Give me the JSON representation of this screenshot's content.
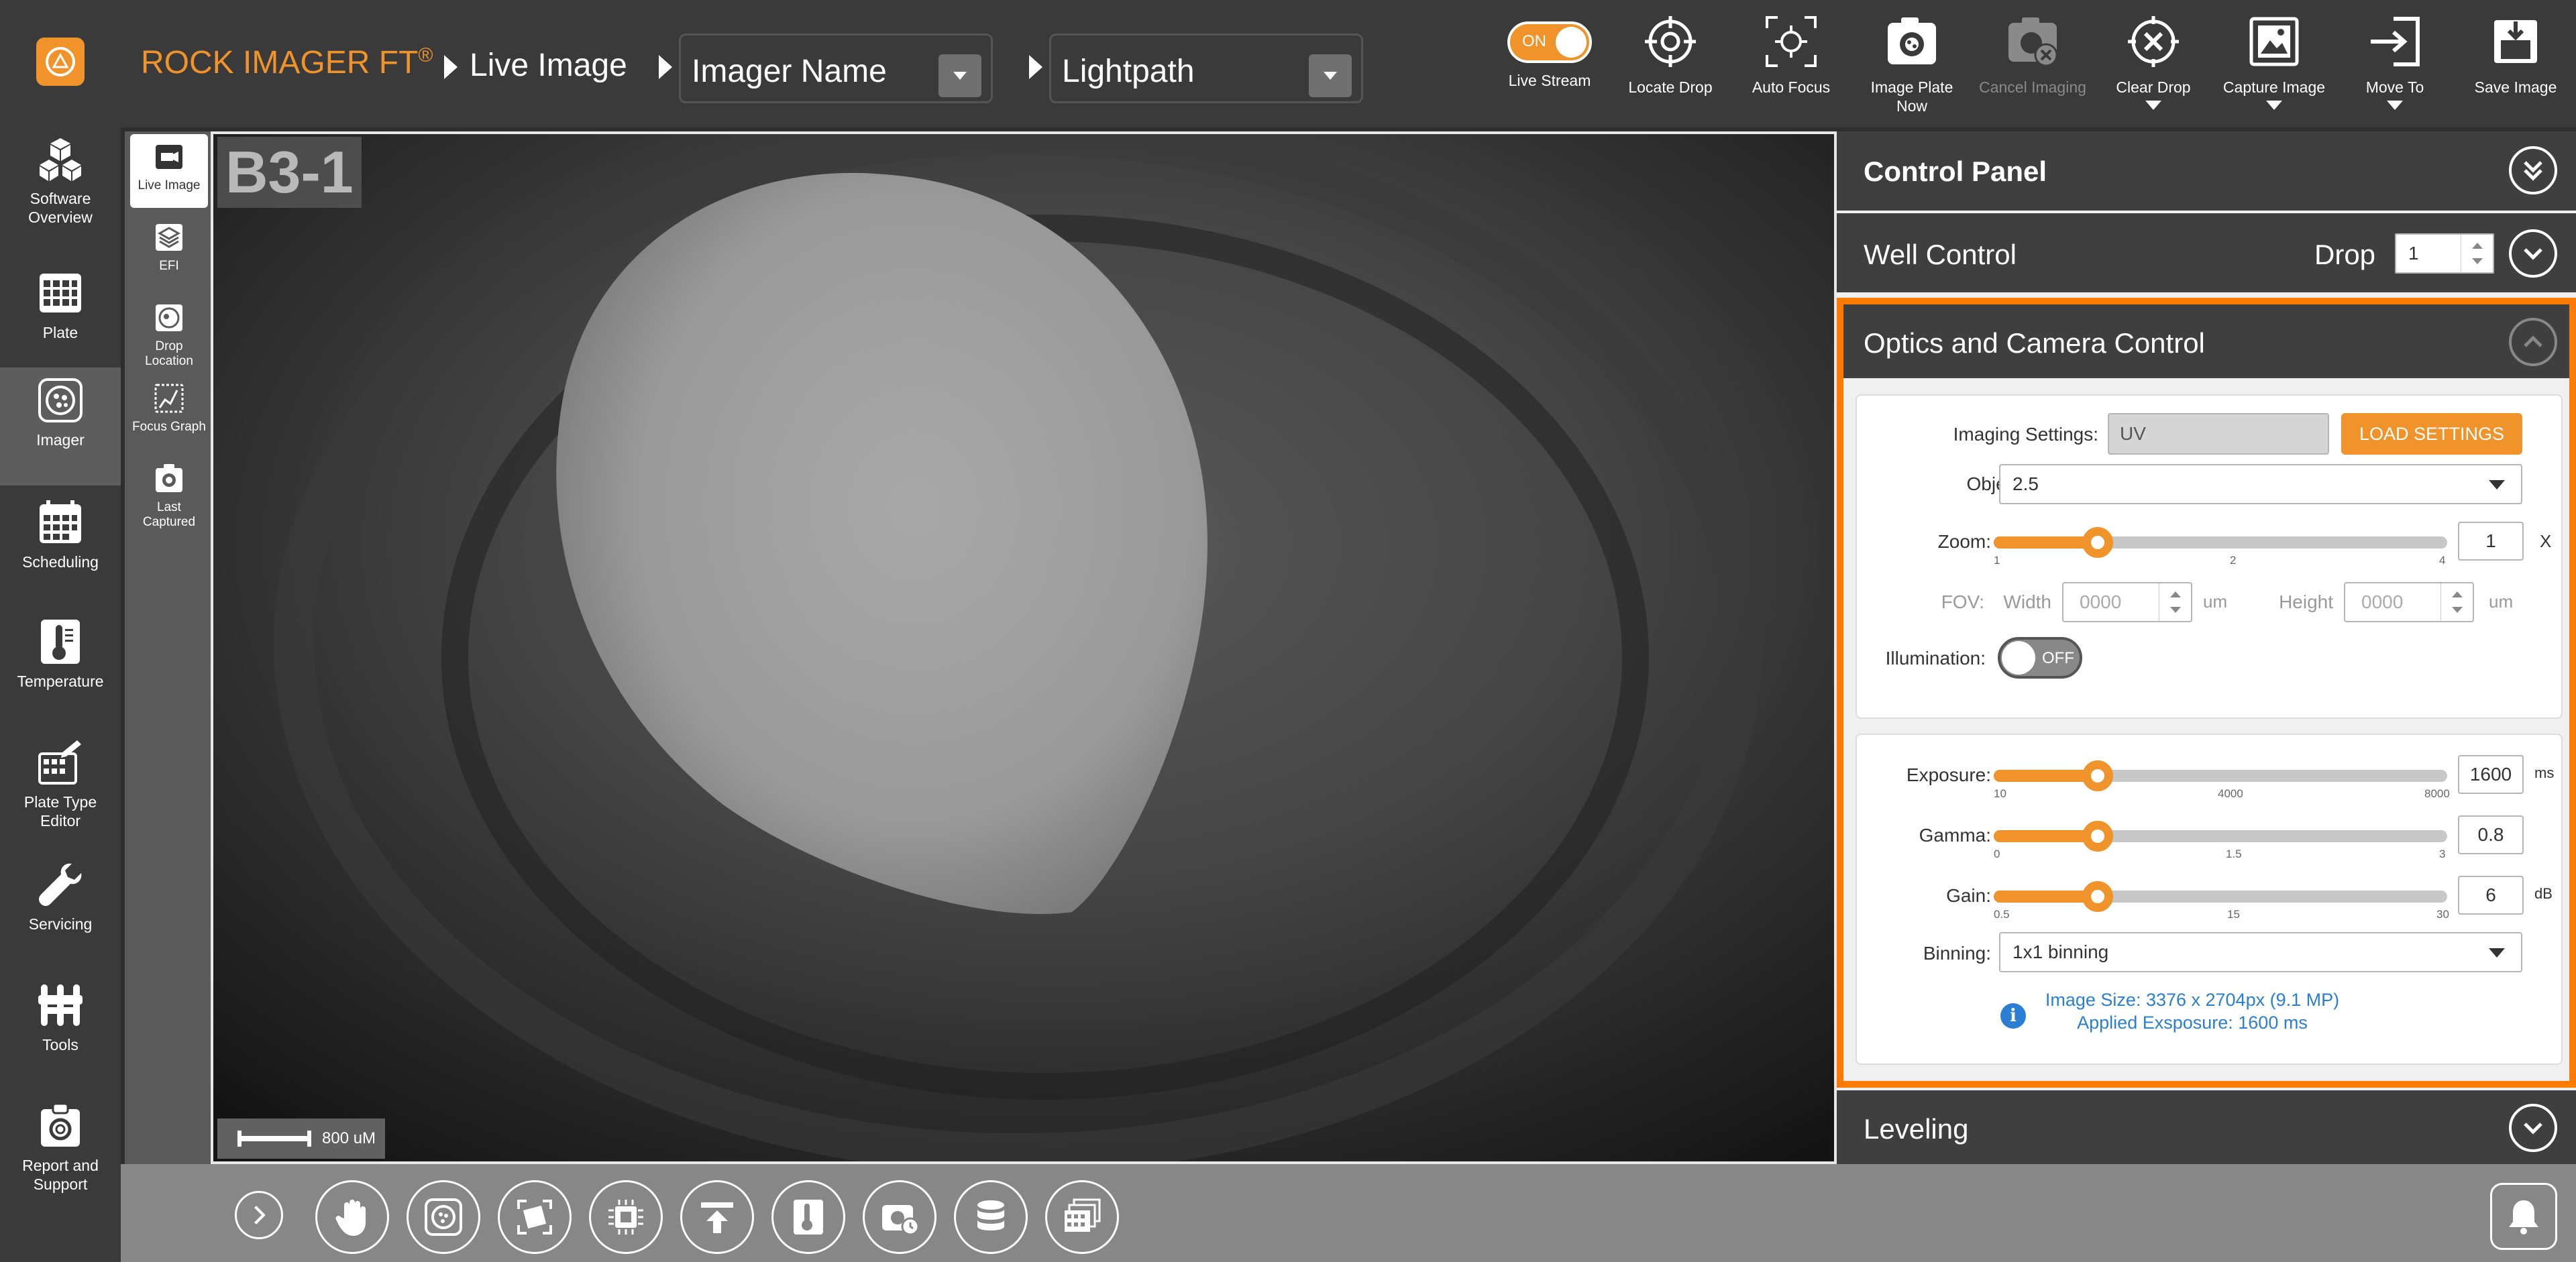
{
  "app": {
    "title": "ROCK IMAGER FT",
    "reg_mark": "®"
  },
  "breadcrumb": {
    "page": "Live Image",
    "imager_name": "Imager Name",
    "lightpath": "Lightpath"
  },
  "left_nav": [
    {
      "label": "Software Overview",
      "icon": "cubes-icon"
    },
    {
      "label": "Plate",
      "icon": "grid-icon"
    },
    {
      "label": "Imager",
      "icon": "microscope-plate-icon",
      "active": true
    },
    {
      "label": "Scheduling",
      "icon": "calendar-icon"
    },
    {
      "label": "Temperature",
      "icon": "thermometer-icon"
    },
    {
      "label": "Plate Type Editor",
      "icon": "plate-edit-icon"
    },
    {
      "label": "Servicing",
      "icon": "wrench-icon"
    },
    {
      "label": "Tools",
      "icon": "tools-icon"
    },
    {
      "label": "Report and Support",
      "icon": "support-icon"
    }
  ],
  "toolbar": {
    "live_stream": {
      "label": "Live Stream",
      "toggle": "ON"
    },
    "buttons": [
      {
        "label": "Locate Drop",
        "icon": "crosshair-icon"
      },
      {
        "label": "Auto Focus",
        "icon": "autofocus-icon"
      },
      {
        "label": "Image Plate Now",
        "icon": "camera-plate-icon"
      },
      {
        "label": "Cancel Imaging",
        "icon": "cancel-camera-icon",
        "disabled": true
      },
      {
        "label": "Clear Drop",
        "icon": "clear-drop-icon",
        "caret": true
      },
      {
        "label": "Capture Image",
        "icon": "capture-image-icon",
        "caret": true
      },
      {
        "label": "Move To",
        "icon": "move-to-icon",
        "caret": true
      },
      {
        "label": "Save Image",
        "icon": "save-image-icon"
      }
    ]
  },
  "sub_nav": [
    {
      "label": "Live Image",
      "active": true
    },
    {
      "label": "EFI"
    },
    {
      "label": "Drop Location"
    },
    {
      "label": "Focus Graph"
    },
    {
      "label": "Last Captured"
    }
  ],
  "viewer": {
    "well": "B3-1",
    "scale": "800 uM"
  },
  "panel": {
    "control_panel": "Control Panel",
    "well_control": {
      "title": "Well Control",
      "drop_label": "Drop",
      "drop_value": "1"
    },
    "optics": {
      "title": "Optics and Camera Control",
      "imaging_settings_label": "Imaging Settings:",
      "imaging_settings_value": "UV",
      "load_button": "LOAD SETTINGS",
      "objective_label": "Objective:",
      "objective_value": "2.5",
      "zoom": {
        "label": "Zoom:",
        "value": "1",
        "unit": "X",
        "ticks": [
          "1",
          "2",
          "4"
        ],
        "level": 0.23
      },
      "fov": {
        "label": "FOV:",
        "width_label": "Width",
        "width_value": "0000",
        "height_label": "Height",
        "height_value": "0000",
        "unit": "um"
      },
      "illumination": {
        "label": "Illumination:",
        "state": "OFF"
      },
      "exposure": {
        "label": "Exposure:",
        "value": "1600",
        "unit": "ms",
        "ticks": [
          "10",
          "4000",
          "8000"
        ],
        "level": 0.23
      },
      "gamma": {
        "label": "Gamma:",
        "value": "0.8",
        "ticks": [
          "0",
          "1.5",
          "3"
        ],
        "level": 0.23
      },
      "gain": {
        "label": "Gain:",
        "value": "6",
        "unit": "dB",
        "ticks": [
          "0.5",
          "15",
          "30"
        ],
        "level": 0.23
      },
      "binning": {
        "label": "Binning:",
        "value": "1x1 binning"
      },
      "info_line1": "Image Size: 3376 x 2704px (9.1 MP)",
      "info_line2": "Applied Exsposure: 1600 ms"
    },
    "leveling": "Leveling"
  },
  "colors": {
    "accent": "#f0932b",
    "highlight_border": "#ff7a00",
    "info_blue": "#2a7fd4"
  },
  "bottom_bar_icons": [
    "expand-icon",
    "hand-icon",
    "plate-icon",
    "rotate-crop-icon",
    "chip-icon",
    "upload-icon",
    "temperature-report-icon",
    "timed-camera-icon",
    "database-icon",
    "image-stack-icon",
    "notification-icon"
  ]
}
